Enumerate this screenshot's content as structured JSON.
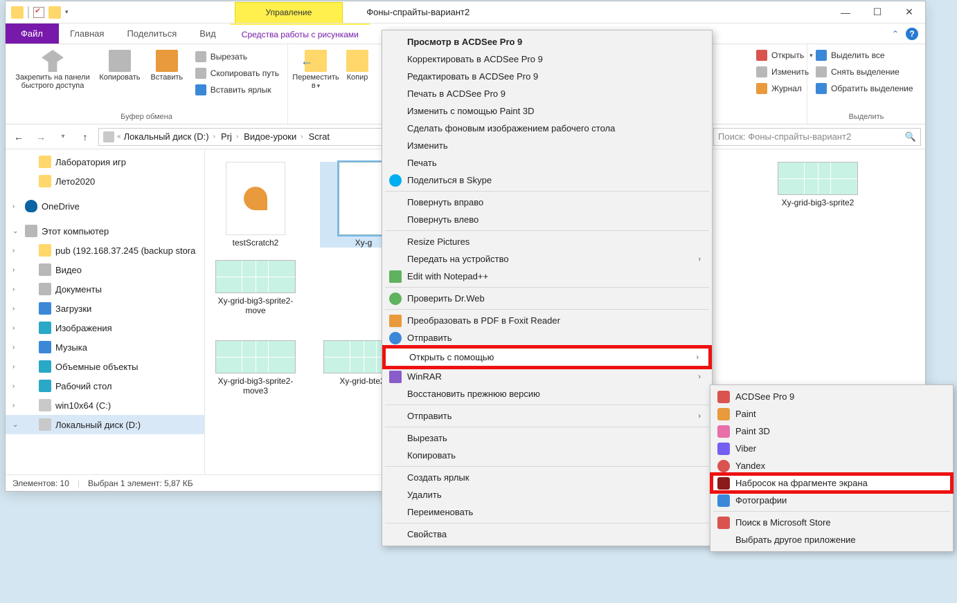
{
  "window": {
    "title": "Фоны-спрайты-вариант2",
    "manage_tab": "Управление",
    "manage_sub": "Средства работы с рисунками"
  },
  "ribbon_tabs": {
    "file": "Файл",
    "home": "Главная",
    "share": "Поделиться",
    "view": "Вид"
  },
  "ribbon": {
    "clipboard": {
      "pin": "Закрепить на панели быстрого доступа",
      "copy": "Копировать",
      "paste": "Вставить",
      "cut": "Вырезать",
      "copy_path": "Скопировать путь",
      "paste_shortcut": "Вставить ярлык",
      "label": "Буфер обмена"
    },
    "organize": {
      "move_to": "Переместить в",
      "copy_to": "Копир"
    },
    "open": {
      "open": "Открыть",
      "edit": "Изменить",
      "history": "Журнал"
    },
    "select": {
      "select_all": "Выделить все",
      "select_none": "Снять выделение",
      "invert": "Обратить выделение",
      "label": "Выделить"
    }
  },
  "breadcrumb": {
    "parts": [
      "Локальный диск (D:)",
      "Prj",
      "Видое-уроки",
      "Scrat"
    ]
  },
  "search": {
    "placeholder": "Поиск: Фоны-спрайты-вариант2"
  },
  "tree": {
    "lab": "Лаборатория игр",
    "summer": "Лето2020",
    "onedrive": "OneDrive",
    "thispc": "Этот компьютер",
    "pub": "pub (192.168.37.245 (backup stora",
    "videos": "Видео",
    "documents": "Документы",
    "downloads": "Загрузки",
    "pictures": "Изображения",
    "music": "Музыка",
    "objects3d": "Объемные объекты",
    "desktop": "Рабочий стол",
    "win10": "win10x64 (C:)",
    "diskD": "Локальный диск (D:)"
  },
  "files": [
    {
      "name": "testScratch2",
      "kind": "catfile"
    },
    {
      "name": "Xy-g",
      "kind": "grid",
      "selected": true
    },
    {
      "name": "Xy-grid-big3-sprite2",
      "kind": "grid"
    },
    {
      "name": "Xy-grid-big3-sprite2-move",
      "kind": "grid"
    },
    {
      "name": "Xy-grid-big3-sprite2-move3",
      "kind": "grid"
    },
    {
      "name": "Xy-grid-bte2-",
      "kind": "grid"
    }
  ],
  "status": {
    "count": "Элементов: 10",
    "selection": "Выбран 1 элемент: 5,87 КБ"
  },
  "context_menu": {
    "view_acdsee": "Просмотр в ACDSee Pro 9",
    "correct_acdsee": "Корректировать в ACDSee Pro 9",
    "edit_acdsee": "Редактировать в ACDSee Pro 9",
    "print_acdsee": "Печать в ACDSee Pro 9",
    "paint3d_edit": "Изменить с помощью Paint 3D",
    "set_wallpaper": "Сделать фоновым изображением рабочего стола",
    "edit": "Изменить",
    "print": "Печать",
    "skype_share": "Поделиться в Skype",
    "rotate_right": "Повернуть вправо",
    "rotate_left": "Повернуть влево",
    "resize": "Resize Pictures",
    "cast": "Передать на устройство",
    "notepadpp": "Edit with Notepad++",
    "drweb": "Проверить Dr.Web",
    "foxit": "Преобразовать в PDF в Foxit Reader",
    "send1": "Отправить",
    "open_with": "Открыть с помощью",
    "winrar": "WinRAR",
    "restore": "Восстановить прежнюю версию",
    "send2": "Отправить",
    "cut": "Вырезать",
    "copy": "Копировать",
    "shortcut": "Создать ярлык",
    "delete": "Удалить",
    "rename": "Переименовать",
    "properties": "Свойства"
  },
  "submenu": {
    "acdsee": "ACDSee Pro 9",
    "paint": "Paint",
    "paint3d": "Paint 3D",
    "viber": "Viber",
    "yandex": "Yandex",
    "snip": "Набросок на фрагменте экрана",
    "photos": "Фотографии",
    "store": "Поиск в Microsoft Store",
    "other": "Выбрать другое приложение"
  }
}
